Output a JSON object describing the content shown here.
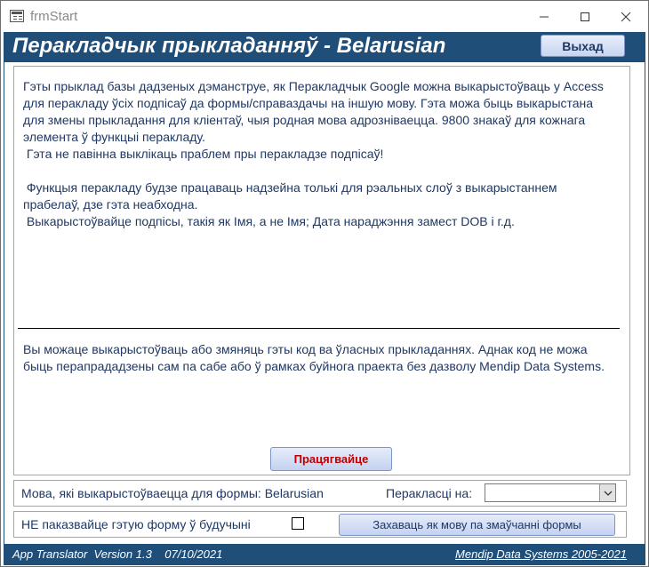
{
  "window": {
    "title": "frmStart",
    "icons": {
      "app": "form-icon",
      "minimize": "minimize-icon",
      "maximize": "maximize-icon",
      "close": "close-icon"
    }
  },
  "header": {
    "title": "Перакладчык прыкладанняў - Belarusian",
    "exit_label": "Выхад",
    "background": "#1f4e79"
  },
  "intro": {
    "paragraphs": [
      "Гэты прыклад базы дадзеных дэманструе, як Перакладчык Google можна выкарыстоўваць у Access для перакладу ўсіх подпісаў да формы/справаздачы на іншую мову. Гэта можа быць выкарыстана для змены прыкладання для кліентаў, чыя родная мова адрозніваецца. 9800 знакаў для кожнага элемента ў функцыі перакладу.",
      " Гэта не павінна выклікаць праблем пры перакладзе подпісаў!",
      "",
      " Функцыя перакладу будзе працаваць надзейна толькі для рэальных слоў з выкарыстаннем прабелаў, дзе гэта неабходна.",
      " Выкарыстоўвайце подпісы, такія як Імя, а не Імя; Дата нараджэння замест DOB і г.д."
    ]
  },
  "license_text": "Вы можаце выкарыстоўваць або змяняць гэты код ва ўласных прыкладаннях. Аднак код не можа быць перапрададзены сам па сабе або ў рамках буйнога праекта без дазволу Mendip Data Systems.",
  "start_button": {
    "label": "Працягвайце",
    "color": "#c00000"
  },
  "language_row": {
    "label": "Мова, які выкарыстоўваецца для формы: Belarusian",
    "translate_label": "Перакласці на:",
    "translate_value": ""
  },
  "options_row": {
    "no_show_label": "НЕ паказвайце гэтую форму ў будучыні",
    "no_show_checked": false,
    "default_button_label": "Захаваць як мову па змаўчанні формы"
  },
  "footer": {
    "app_info": "App Translator  Version 1.3    07/10/2021",
    "company": "Mendip Data Systems 2005-2021"
  }
}
